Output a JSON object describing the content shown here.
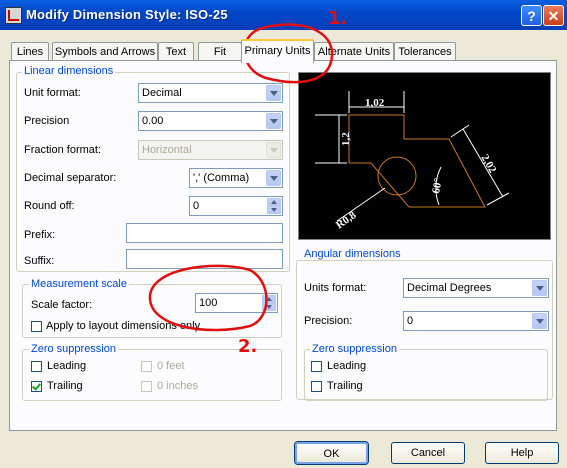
{
  "window": {
    "title": "Modify Dimension Style: ISO-25",
    "help_glyph": "?",
    "close_glyph": "✕"
  },
  "tabs": [
    "Lines",
    "Symbols and Arrows",
    "Text",
    "Fit",
    "Primary Units",
    "Alternate Units",
    "Tolerances"
  ],
  "active_tab": "Primary Units",
  "linear": {
    "group_label": "Linear dimensions",
    "unit_format": {
      "label": "Unit format:",
      "value": "Decimal"
    },
    "precision": {
      "label": "Precision",
      "value": "0.00"
    },
    "fraction_format": {
      "label": "Fraction format:",
      "value": "Horizontal"
    },
    "decimal_separator": {
      "label": "Decimal separator:",
      "value": "',' (Comma)"
    },
    "round_off": {
      "label": "Round off:",
      "value": "0"
    },
    "prefix": {
      "label": "Prefix:",
      "value": ""
    },
    "suffix": {
      "label": "Suffix:",
      "value": ""
    }
  },
  "measurement": {
    "group_label": "Measurement scale",
    "scale_factor": {
      "label": "Scale factor:",
      "value": "100"
    },
    "apply_layout": {
      "label": "Apply to layout dimensions only",
      "checked": false
    }
  },
  "zero_linear": {
    "group_label": "Zero suppression",
    "leading": {
      "label": "Leading",
      "checked": false
    },
    "trailing": {
      "label": "Trailing",
      "checked": true
    },
    "feet": {
      "label": "0 feet",
      "checked": false
    },
    "inches": {
      "label": "0 inches",
      "checked": false
    }
  },
  "preview": {
    "dim_top": "1,02",
    "dim_left": "1,2",
    "dim_right": "2,02",
    "dim_angle": "60°",
    "dim_radius": "R0,8"
  },
  "angular": {
    "group_label": "Angular dimensions",
    "units_format": {
      "label": "Units format:",
      "value": "Decimal Degrees"
    },
    "precision": {
      "label": "Precision:",
      "value": "0"
    }
  },
  "zero_angular": {
    "group_label": "Zero suppression",
    "leading": {
      "label": "Leading",
      "checked": false
    },
    "trailing": {
      "label": "Trailing",
      "checked": false
    }
  },
  "annotations": {
    "mark1": "1.",
    "mark2": "2."
  },
  "buttons": {
    "ok": "OK",
    "cancel": "Cancel",
    "help": "Help"
  }
}
